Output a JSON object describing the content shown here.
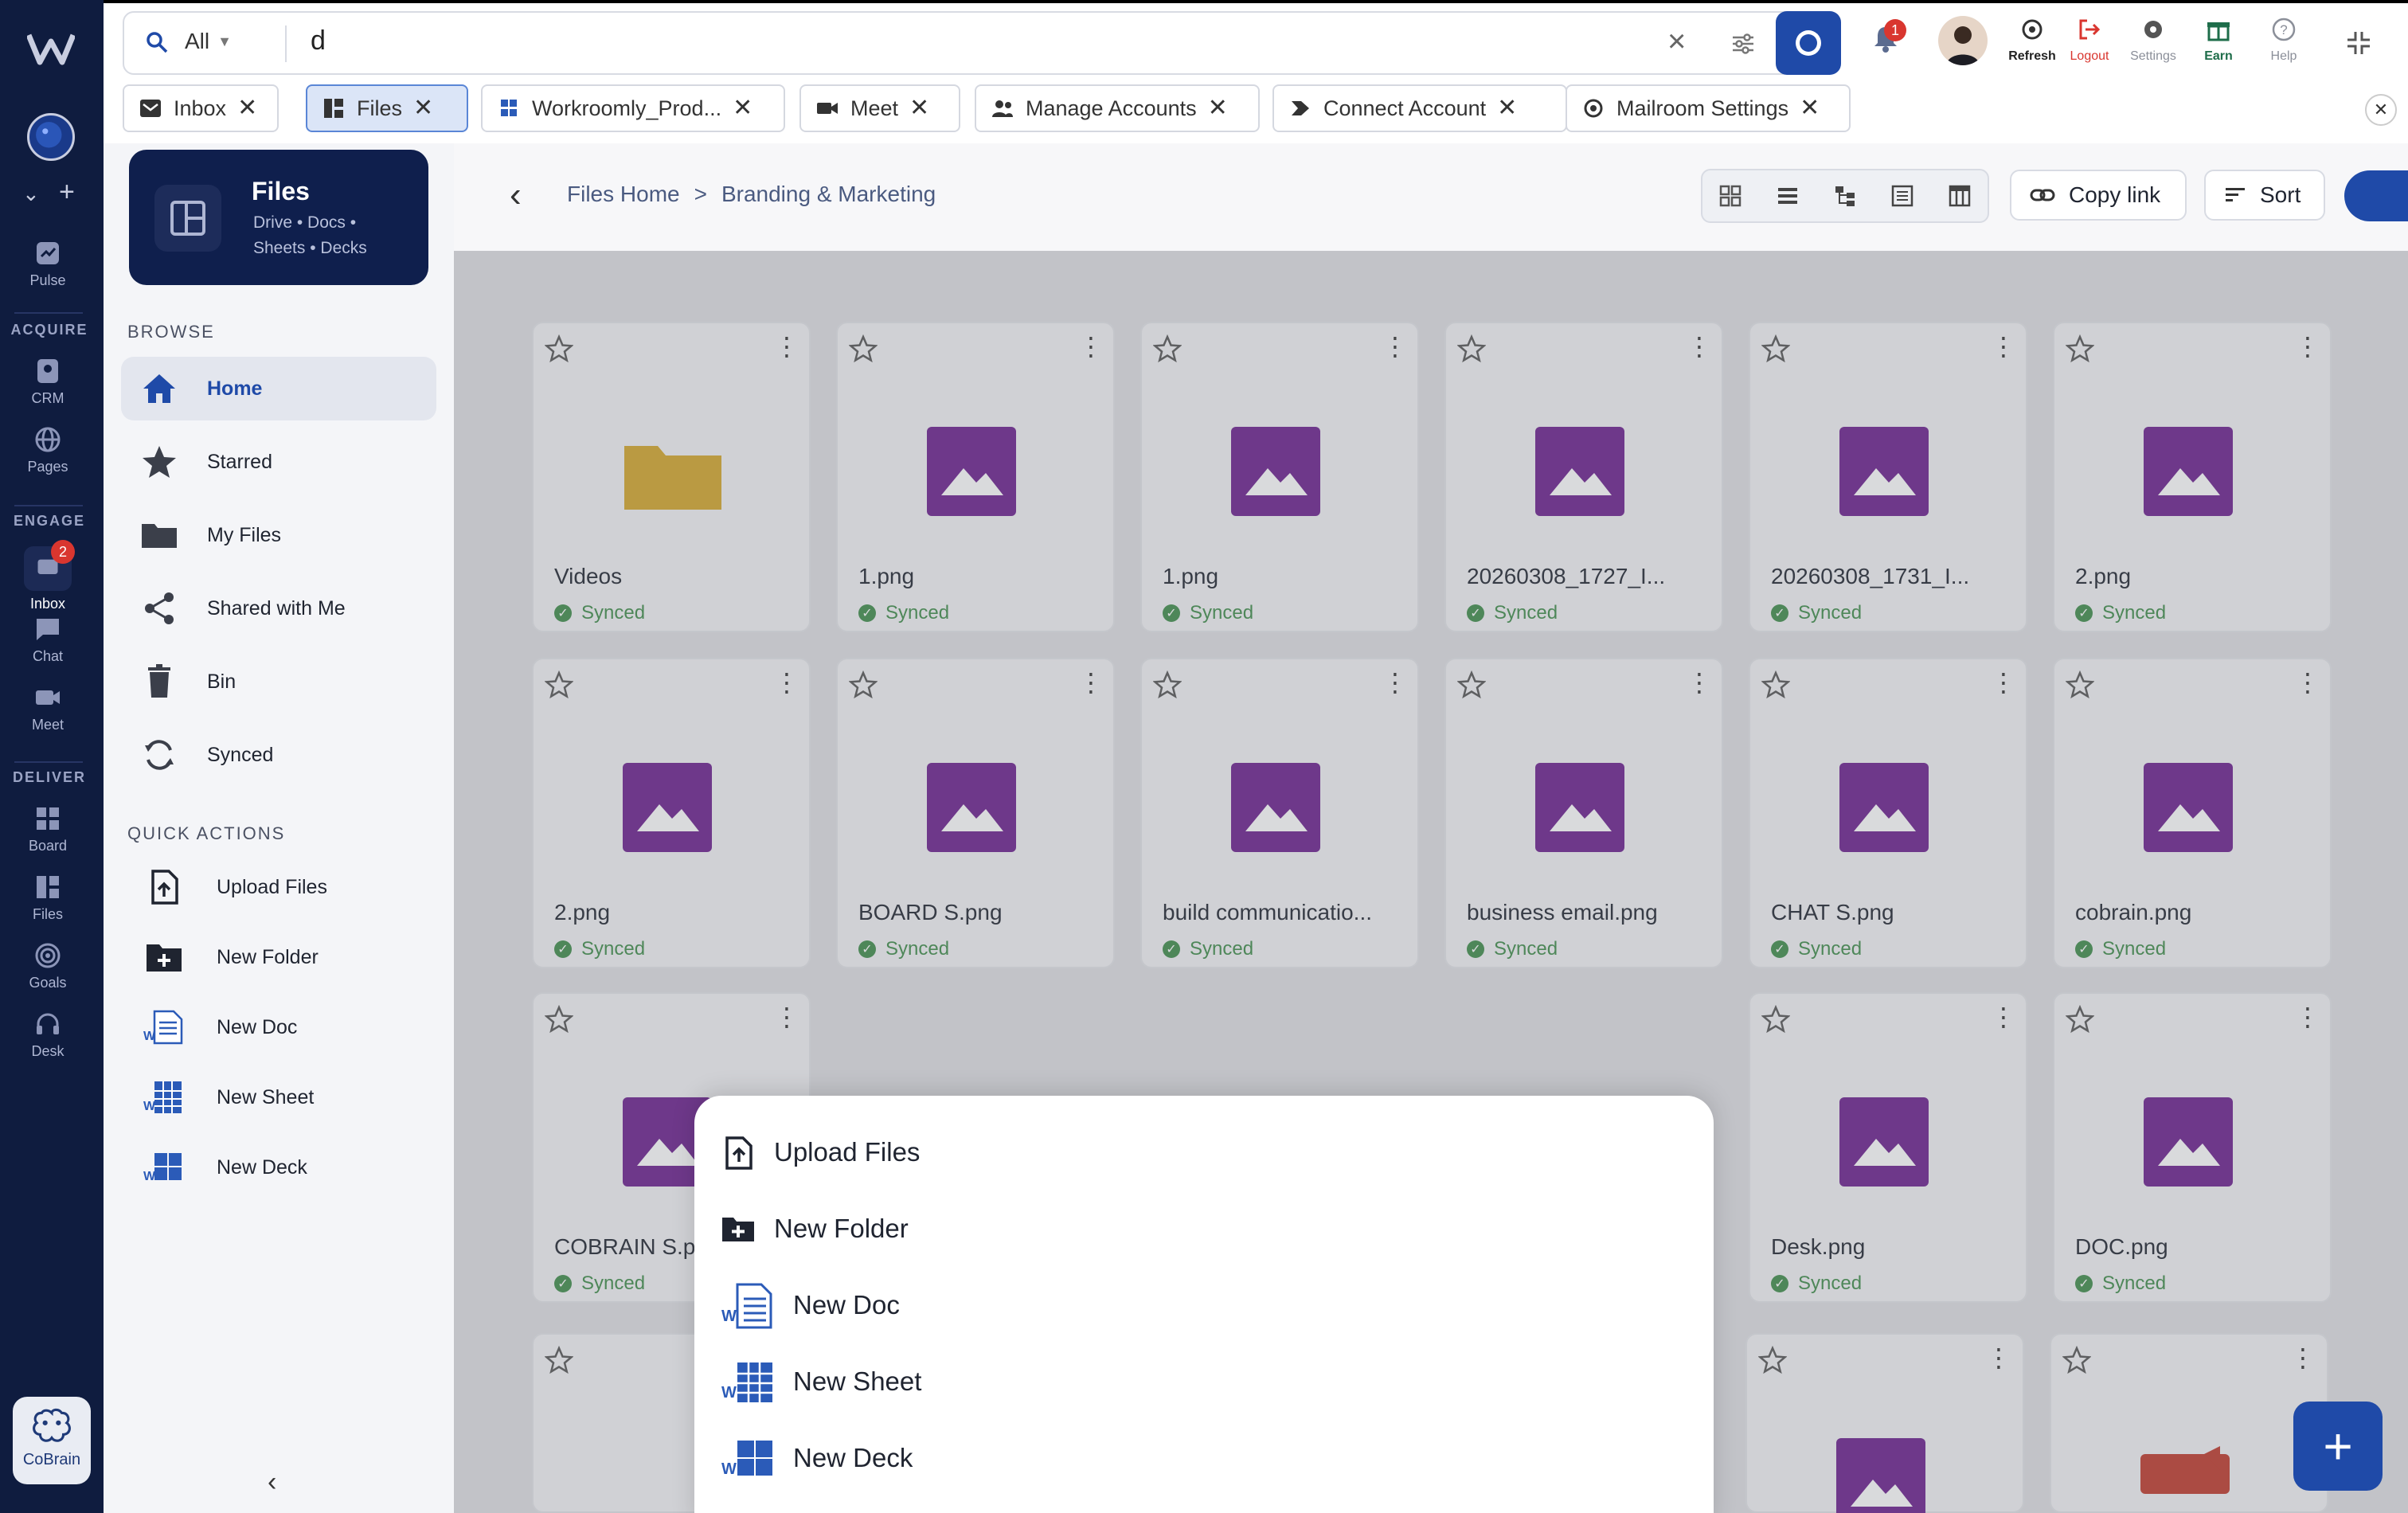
{
  "app": {
    "cobrain_label": "CoBrain"
  },
  "search": {
    "scope": "All",
    "query": "d"
  },
  "top_actions": [
    {
      "label": "Refresh"
    },
    {
      "label": "Logout"
    },
    {
      "label": "Settings"
    },
    {
      "label": "Earn"
    },
    {
      "label": "Help"
    }
  ],
  "notifications": {
    "count": "1"
  },
  "tabs": [
    {
      "label": "Inbox"
    },
    {
      "label": "Files"
    },
    {
      "label": "Workroomly_Prod..."
    },
    {
      "label": "Meet"
    },
    {
      "label": "Manage Accounts"
    },
    {
      "label": "Connect Account"
    },
    {
      "label": "Mailroom Settings"
    }
  ],
  "rail": {
    "sections": {
      "acquire": "ACQUIRE",
      "engage": "ENGAGE",
      "deliver": "DELIVER"
    },
    "items": {
      "pulse": "Pulse",
      "crm": "CRM",
      "pages": "Pages",
      "inbox": "Inbox",
      "inbox_badge": "2",
      "chat": "Chat",
      "meet": "Meet",
      "board": "Board",
      "files": "Files",
      "goals": "Goals",
      "desk": "Desk"
    }
  },
  "sidebar": {
    "header": {
      "title": "Files",
      "subtitle_line1": "Drive • Docs •",
      "subtitle_line2": "Sheets • Decks"
    },
    "browse_label": "BROWSE",
    "browse": [
      {
        "label": "Home"
      },
      {
        "label": "Starred"
      },
      {
        "label": "My Files"
      },
      {
        "label": "Shared with Me"
      },
      {
        "label": "Bin"
      },
      {
        "label": "Synced"
      }
    ],
    "quick_label": "QUICK ACTIONS",
    "quick": [
      {
        "label": "Upload Files"
      },
      {
        "label": "New Folder"
      },
      {
        "label": "New Doc"
      },
      {
        "label": "New Sheet"
      },
      {
        "label": "New Deck"
      }
    ]
  },
  "breadcrumb": {
    "root": "Files Home",
    "separator": ">",
    "current": "Branding & Marketing"
  },
  "toolbar": {
    "copy_link": "Copy link",
    "sort": "Sort"
  },
  "files": [
    {
      "name": "Videos",
      "status": "Synced",
      "type": "folder"
    },
    {
      "name": "1.png",
      "status": "Synced",
      "type": "image"
    },
    {
      "name": "1.png",
      "status": "Synced",
      "type": "image"
    },
    {
      "name": "20260308_1727_I...",
      "status": "Synced",
      "type": "image"
    },
    {
      "name": "20260308_1731_I...",
      "status": "Synced",
      "type": "image"
    },
    {
      "name": "2.png",
      "status": "Synced",
      "type": "image"
    },
    {
      "name": "2.png",
      "status": "Synced",
      "type": "image"
    },
    {
      "name": "BOARD S.png",
      "status": "Synced",
      "type": "image"
    },
    {
      "name": "build communicatio...",
      "status": "Synced",
      "type": "image"
    },
    {
      "name": "business email.png",
      "status": "Synced",
      "type": "image"
    },
    {
      "name": "CHAT S.png",
      "status": "Synced",
      "type": "image"
    },
    {
      "name": "cobrain.png",
      "status": "Synced",
      "type": "image"
    },
    {
      "name": "COBRAIN S.p",
      "status": "Synced",
      "type": "image"
    },
    {
      "name": "Desk.png",
      "status": "Synced",
      "type": "image"
    },
    {
      "name": "DOC.png",
      "status": "Synced",
      "type": "image"
    }
  ],
  "sheet": {
    "items": [
      {
        "label": "Upload Files"
      },
      {
        "label": "New Folder"
      },
      {
        "label": "New Doc"
      },
      {
        "label": "New Sheet"
      },
      {
        "label": "New Deck"
      }
    ]
  },
  "colors": {
    "rail_bg": "#0f1c3f",
    "image_icon": "#6b1f8e",
    "folder_icon": "#d4a72a",
    "synced": "#3f8d4a",
    "accent": "#1f4aa8"
  }
}
